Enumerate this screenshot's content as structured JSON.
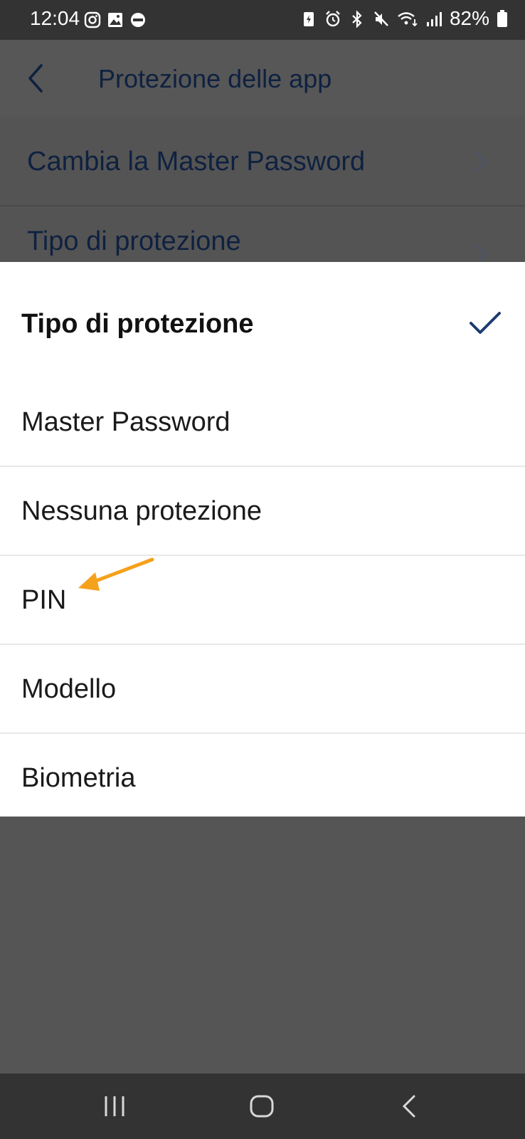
{
  "status_bar": {
    "time": "12:04",
    "battery": "82%",
    "left_icons": [
      "instagram-icon",
      "gallery-icon",
      "wear-icon"
    ],
    "right_icons": [
      "battery-saver-icon",
      "alarm-icon",
      "bluetooth-icon",
      "mute-icon",
      "wifi-icon",
      "signal-icon",
      "battery-icon"
    ]
  },
  "header": {
    "title": "Protezione delle app",
    "back_icon": "back-arrow-icon"
  },
  "settings": {
    "items": [
      {
        "label": "Cambia la Master Password"
      },
      {
        "label": "Tipo di protezione"
      }
    ]
  },
  "sheet": {
    "title": "Tipo di protezione",
    "check_icon": "checkmark-icon",
    "options": [
      {
        "label": "Master Password"
      },
      {
        "label": "Nessuna protezione"
      },
      {
        "label": "PIN"
      },
      {
        "label": "Modello"
      },
      {
        "label": "Biometria"
      }
    ]
  },
  "colors": {
    "accent": "#1d3b6e",
    "annotation_arrow": "#f5a11c",
    "status_bar": "#333333",
    "dim_overlay": "#555555"
  },
  "nav_bar": {
    "icons": [
      "recent-apps-icon",
      "home-icon",
      "back-icon"
    ]
  }
}
